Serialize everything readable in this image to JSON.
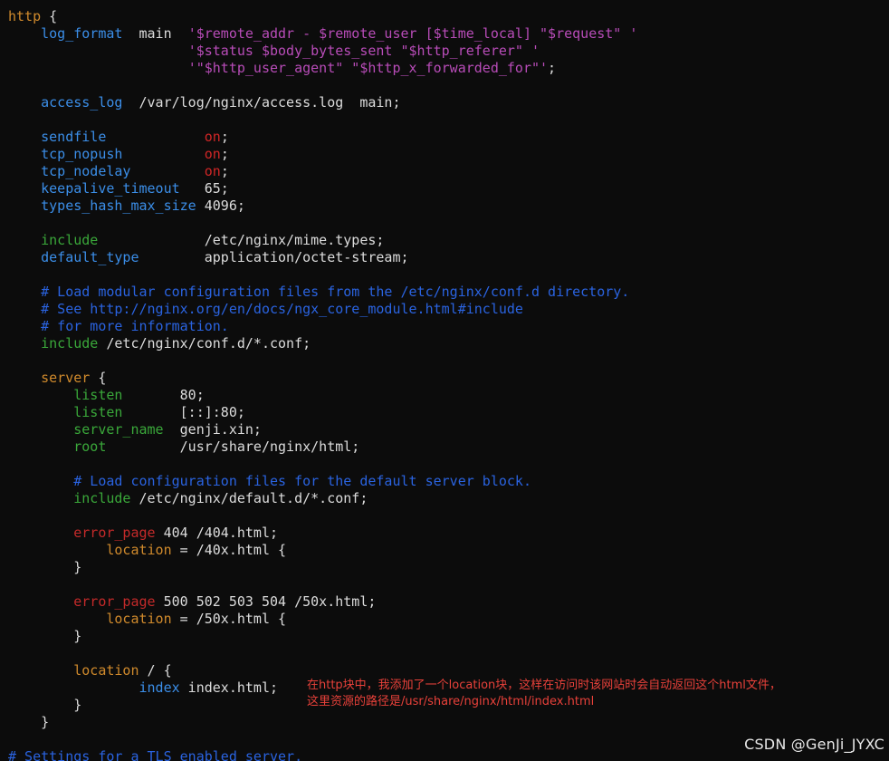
{
  "lines": [
    [
      {
        "t": "http",
        "c": "block"
      },
      {
        "t": " {",
        "c": "plain"
      }
    ],
    [
      {
        "t": "    ",
        "c": "plain"
      },
      {
        "t": "log_format",
        "c": "dir"
      },
      {
        "t": "  main  ",
        "c": "plain"
      },
      {
        "t": "'$remote_addr - $remote_user [$time_local] \"$request\" '",
        "c": "str"
      }
    ],
    [
      {
        "t": "                      ",
        "c": "plain"
      },
      {
        "t": "'$status $body_bytes_sent \"$http_referer\" '",
        "c": "str"
      }
    ],
    [
      {
        "t": "                      ",
        "c": "plain"
      },
      {
        "t": "'\"$http_user_agent\" \"$http_x_forwarded_for\"'",
        "c": "str"
      },
      {
        "t": ";",
        "c": "plain"
      }
    ],
    [],
    [
      {
        "t": "    ",
        "c": "plain"
      },
      {
        "t": "access_log",
        "c": "dir"
      },
      {
        "t": "  /var/log/nginx/access.log  main;",
        "c": "plain"
      }
    ],
    [],
    [
      {
        "t": "    ",
        "c": "plain"
      },
      {
        "t": "sendfile",
        "c": "dir"
      },
      {
        "t": "            ",
        "c": "plain"
      },
      {
        "t": "on",
        "c": "on"
      },
      {
        "t": ";",
        "c": "plain"
      }
    ],
    [
      {
        "t": "    ",
        "c": "plain"
      },
      {
        "t": "tcp_nopush",
        "c": "dir"
      },
      {
        "t": "          ",
        "c": "plain"
      },
      {
        "t": "on",
        "c": "on"
      },
      {
        "t": ";",
        "c": "plain"
      }
    ],
    [
      {
        "t": "    ",
        "c": "plain"
      },
      {
        "t": "tcp_nodelay",
        "c": "dir"
      },
      {
        "t": "         ",
        "c": "plain"
      },
      {
        "t": "on",
        "c": "on"
      },
      {
        "t": ";",
        "c": "plain"
      }
    ],
    [
      {
        "t": "    ",
        "c": "plain"
      },
      {
        "t": "keepalive_timeout",
        "c": "dir"
      },
      {
        "t": "   65;",
        "c": "plain"
      }
    ],
    [
      {
        "t": "    ",
        "c": "plain"
      },
      {
        "t": "types_hash_max_size",
        "c": "dir"
      },
      {
        "t": " 4096;",
        "c": "plain"
      }
    ],
    [],
    [
      {
        "t": "    ",
        "c": "plain"
      },
      {
        "t": "include",
        "c": "green"
      },
      {
        "t": "             /etc/nginx/mime.types;",
        "c": "plain"
      }
    ],
    [
      {
        "t": "    ",
        "c": "plain"
      },
      {
        "t": "default_type",
        "c": "dir"
      },
      {
        "t": "        application/octet-stream;",
        "c": "plain"
      }
    ],
    [],
    [
      {
        "t": "    ",
        "c": "plain"
      },
      {
        "t": "# Load modular configuration files from the /etc/nginx/conf.d directory.",
        "c": "comment"
      }
    ],
    [
      {
        "t": "    ",
        "c": "plain"
      },
      {
        "t": "# See http://nginx.org/en/docs/ngx_core_module.html#include",
        "c": "comment"
      }
    ],
    [
      {
        "t": "    ",
        "c": "plain"
      },
      {
        "t": "# for more information.",
        "c": "comment"
      }
    ],
    [
      {
        "t": "    ",
        "c": "plain"
      },
      {
        "t": "include",
        "c": "green"
      },
      {
        "t": " /etc/nginx/conf.d/*.conf;",
        "c": "plain"
      }
    ],
    [],
    [
      {
        "t": "    ",
        "c": "plain"
      },
      {
        "t": "server",
        "c": "block"
      },
      {
        "t": " {",
        "c": "plain"
      }
    ],
    [
      {
        "t": "        ",
        "c": "plain"
      },
      {
        "t": "listen",
        "c": "green"
      },
      {
        "t": "       80;",
        "c": "plain"
      }
    ],
    [
      {
        "t": "        ",
        "c": "plain"
      },
      {
        "t": "listen",
        "c": "green"
      },
      {
        "t": "       [::]:80;",
        "c": "plain"
      }
    ],
    [
      {
        "t": "        ",
        "c": "plain"
      },
      {
        "t": "server_name",
        "c": "green"
      },
      {
        "t": "  genji.xin;",
        "c": "plain"
      }
    ],
    [
      {
        "t": "        ",
        "c": "plain"
      },
      {
        "t": "root",
        "c": "green"
      },
      {
        "t": "         /usr/share/nginx/html;",
        "c": "plain"
      }
    ],
    [],
    [
      {
        "t": "        ",
        "c": "plain"
      },
      {
        "t": "# Load configuration files for the default server block.",
        "c": "comment"
      }
    ],
    [
      {
        "t": "        ",
        "c": "plain"
      },
      {
        "t": "include",
        "c": "green"
      },
      {
        "t": " /etc/nginx/default.d/*.conf;",
        "c": "plain"
      }
    ],
    [],
    [
      {
        "t": "        ",
        "c": "plain"
      },
      {
        "t": "error_page",
        "c": "err"
      },
      {
        "t": " 404 /404.html;",
        "c": "plain"
      }
    ],
    [
      {
        "t": "            ",
        "c": "plain"
      },
      {
        "t": "location",
        "c": "block"
      },
      {
        "t": " = /40x.html {",
        "c": "plain"
      }
    ],
    [
      {
        "t": "        }",
        "c": "plain"
      }
    ],
    [],
    [
      {
        "t": "        ",
        "c": "plain"
      },
      {
        "t": "error_page",
        "c": "err"
      },
      {
        "t": " 500 502 503 504 /50x.html;",
        "c": "plain"
      }
    ],
    [
      {
        "t": "            ",
        "c": "plain"
      },
      {
        "t": "location",
        "c": "block"
      },
      {
        "t": " = /50x.html {",
        "c": "plain"
      }
    ],
    [
      {
        "t": "        }",
        "c": "plain"
      }
    ],
    [],
    [
      {
        "t": "        ",
        "c": "plain"
      },
      {
        "t": "location",
        "c": "block"
      },
      {
        "t": " / {",
        "c": "plain"
      }
    ],
    [
      {
        "t": "                ",
        "c": "plain"
      },
      {
        "t": "index",
        "c": "index"
      },
      {
        "t": " index.html;",
        "c": "plain"
      }
    ],
    [
      {
        "t": "        }",
        "c": "plain"
      }
    ],
    [
      {
        "t": "    }",
        "c": "plain"
      }
    ],
    [],
    [
      {
        "t": "# Settings for a TLS enabled server.",
        "c": "comment"
      }
    ]
  ],
  "annotation": {
    "line1": "在http块中，我添加了一个location块，这样在访问时该网站时会自动返回这个html文件，",
    "line2": "这里资源的路径是/usr/share/nginx/html/index.html"
  },
  "watermark": "CSDN @GenJi_JYXC",
  "colors": {
    "background": "#0c0c0c",
    "plain": "#dcdcdc",
    "block": "#d08a2c",
    "directive": "#3b8ee8",
    "on": "#d02626",
    "string": "#b84cb8",
    "comment": "#2a63e0",
    "green": "#3aa83a",
    "error_page": "#c42a2a",
    "annotation": "#e8413a"
  }
}
